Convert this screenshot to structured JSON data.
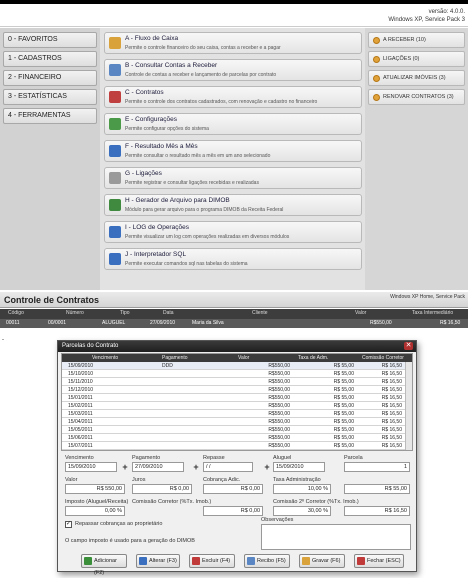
{
  "header": {
    "version": "versão: 4.0.0.",
    "system": "Windows XP, Service Pack 3"
  },
  "left_menu": [
    {
      "label": "0 - FAVORITOS"
    },
    {
      "label": "1 - CADASTROS"
    },
    {
      "label": "2 - FINANCEIRO"
    },
    {
      "label": "3 - ESTATÍSTICAS"
    },
    {
      "label": "4 - FERRAMENTAS"
    }
  ],
  "center_menu": [
    {
      "title": "A - Fluxo de Caixa",
      "desc": "Permite o controle financeiro do seu caixa, contas a receber e a pagar",
      "icon": "cash-flow-icon",
      "color": "#d9a23a"
    },
    {
      "title": "B - Consultar Contas a Receber",
      "desc": "Controle de contas a receber e lançamento de parcelas por contrato",
      "icon": "receivables-icon",
      "color": "#5a86c4"
    },
    {
      "title": "C - Contratos",
      "desc": "Permite o controle dos contratos cadastrados, com renovação e cadastro no financeiro",
      "icon": "contracts-icon",
      "color": "#c04040"
    },
    {
      "title": "E - Configurações",
      "desc": "Permite configurar opções do sistema",
      "icon": "settings-icon",
      "color": "#4a9a4a"
    },
    {
      "title": "F - Resultado Mês a Mês",
      "desc": "Permite consultar o resultado mês a mês em um ano selecionado",
      "icon": "chart-icon",
      "color": "#3a6fbf"
    },
    {
      "title": "G - Ligações",
      "desc": "Permite registrar e consultar ligações recebidas e realizadas",
      "icon": "phone-icon",
      "color": "#9a9a9a"
    },
    {
      "title": "H - Gerador de Arquivo para DIMOB",
      "desc": "Módulo para gerar arquivo para o programa DIMOB da Receita Federal",
      "icon": "dimob-icon",
      "color": "#3f8a3f"
    },
    {
      "title": "I - LOG de Operações",
      "desc": "Permite visualizar um log com operações realizadas em diversos módulos",
      "icon": "log-icon",
      "color": "#3a6fbf"
    },
    {
      "title": "J - Interpretador SQL",
      "desc": "Permite executar comandos sql nas tabelas do sistema",
      "icon": "sql-icon",
      "color": "#3a6fbf"
    }
  ],
  "right_panel": [
    {
      "label": "A RECEBER (10)"
    },
    {
      "label": "LIGAÇÕES (0)"
    },
    {
      "label": "ATUALIZAR IMÓVEIS (3)"
    },
    {
      "label": "RENOVAR CONTRATOS (3)"
    }
  ],
  "contracts_window": {
    "title": "Controle de Contratos",
    "system": "Windows XP Home, Service Pack",
    "columns": [
      "Código",
      "Número",
      "Tipo",
      "Data",
      "Cliente",
      "Valor",
      "Taxa Intermediário"
    ],
    "row": [
      "00011",
      "00/0001",
      "ALUGUEL",
      "27/09/2010",
      "Maria da Silva",
      "R$550,00",
      "R$ 16,50"
    ],
    "mark": "-"
  },
  "dialog": {
    "title": "Parcelas do Contrato",
    "columns": [
      "Vencimento",
      "Pagamento",
      "Valor",
      "Taxa de Adm.",
      "Comissão Corretor"
    ],
    "rows": [
      [
        "15/09/2010",
        "DDD",
        "R$550,00",
        "R$ 55,00",
        "R$ 16,50"
      ],
      [
        "15/10/2010",
        "",
        "R$550,00",
        "R$ 55,00",
        "R$ 16,50"
      ],
      [
        "15/11/2010",
        "",
        "R$550,00",
        "R$ 55,00",
        "R$ 16,50"
      ],
      [
        "15/12/2010",
        "",
        "R$550,00",
        "R$ 55,00",
        "R$ 16,50"
      ],
      [
        "15/01/2011",
        "",
        "R$550,00",
        "R$ 55,00",
        "R$ 16,50"
      ],
      [
        "15/02/2011",
        "",
        "R$550,00",
        "R$ 55,00",
        "R$ 16,50"
      ],
      [
        "15/03/2011",
        "",
        "R$550,00",
        "R$ 55,00",
        "R$ 16,50"
      ],
      [
        "15/04/2011",
        "",
        "R$550,00",
        "R$ 55,00",
        "R$ 16,50"
      ],
      [
        "15/05/2011",
        "",
        "R$550,00",
        "R$ 55,00",
        "R$ 16,50"
      ],
      [
        "15/06/2011",
        "",
        "R$550,00",
        "R$ 55,00",
        "R$ 16,50"
      ],
      [
        "15/07/2011",
        "",
        "R$550,00",
        "R$ 55,00",
        "R$ 16,50"
      ]
    ],
    "fields": {
      "vencimento_label": "Vencimento",
      "vencimento": "15/09/2010",
      "pagamento_label": "Pagamento",
      "pagamento": "27/09/2010",
      "repasse_label": "Repasse",
      "repasse": "/ /",
      "aluguel_label": "Aluguel",
      "aluguel": "15/09/2010",
      "parcela_label": "Parcela",
      "parcela": "1",
      "valor_label": "Valor",
      "valor": "R$ 550,00",
      "juros_label": "Juros",
      "juros": "R$ 0,00",
      "cobranca_label": "Cobrança Adic.",
      "cobranca": "R$ 0,00",
      "taxa_label": "Taxa Administração",
      "taxa": "10,00 %",
      "taxa_valor": "R$ 55,00",
      "imposto_label": "Imposto (Aluguel/Receita)",
      "imposto": "0,00 %",
      "comissao_label": "Comissão Corretor (%Tx. Imob.)",
      "comissao": "R$ 0,00",
      "comissao2_label": "Comissão 2º Corretor (%Tx. Imob.)",
      "comissao2": "30,00 %",
      "comissao2_valor": "R$ 16,50",
      "checkbox_label": "Repassar cobranças ao proprietário",
      "obs_label": "Observações",
      "info_text": "O campo imposto é usado para a geração do DIMOB"
    },
    "buttons": [
      {
        "label": "Adicionar (F2)",
        "icon": "add-icon",
        "color": "#3b8f3b"
      },
      {
        "label": "Alterar (F3)",
        "icon": "edit-icon",
        "color": "#3a6fbf"
      },
      {
        "label": "Excluir (F4)",
        "icon": "delete-icon",
        "color": "#c03a3a"
      },
      {
        "label": "Recibo (F5)",
        "icon": "receipt-icon",
        "color": "#5a86c4"
      },
      {
        "label": "Gravar (F6)",
        "icon": "save-icon",
        "color": "#d9a23a"
      },
      {
        "label": "Fechar (ESC)",
        "icon": "close-icon",
        "color": "#c03a3a"
      }
    ]
  }
}
